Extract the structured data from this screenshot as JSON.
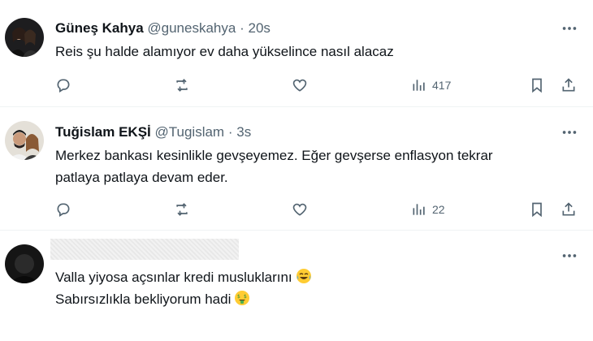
{
  "tweets": [
    {
      "name": "Güneş Kahya",
      "handle": "@guneskahya",
      "dot": "·",
      "time": "20s",
      "lines": [
        "Reis şu halde alamıyor ev daha yükselince nasıl alacaz"
      ],
      "views": "417"
    },
    {
      "name": "Tuğislam EKŞİ",
      "handle": "@Tugislam",
      "dot": "·",
      "time": "3s",
      "lines": [
        "Merkez bankası kesinlikle gevşeyemez. Eğer gevşerse enflasyon tekrar",
        "patlaya patlaya devam eder."
      ],
      "views": "22"
    },
    {
      "name": "",
      "handle": "",
      "dot": "",
      "time": "",
      "lines": [
        "Valla yiyosa açsınlar kredi musluklarını",
        "Sabırsızlıkla bekliyorum hadi"
      ],
      "emojis": [
        "face-with-tears-of-joy",
        "money-mouth-face"
      ]
    }
  ],
  "icons": {
    "more": "more-horizontal-icon",
    "reply": "reply-icon",
    "retweet": "retweet-icon",
    "like": "heart-icon",
    "views": "views-chart-icon",
    "bookmark": "bookmark-icon",
    "share": "share-icon"
  },
  "colors": {
    "text": "#0f1419",
    "secondary": "#536471",
    "divider": "#eff3f4"
  }
}
